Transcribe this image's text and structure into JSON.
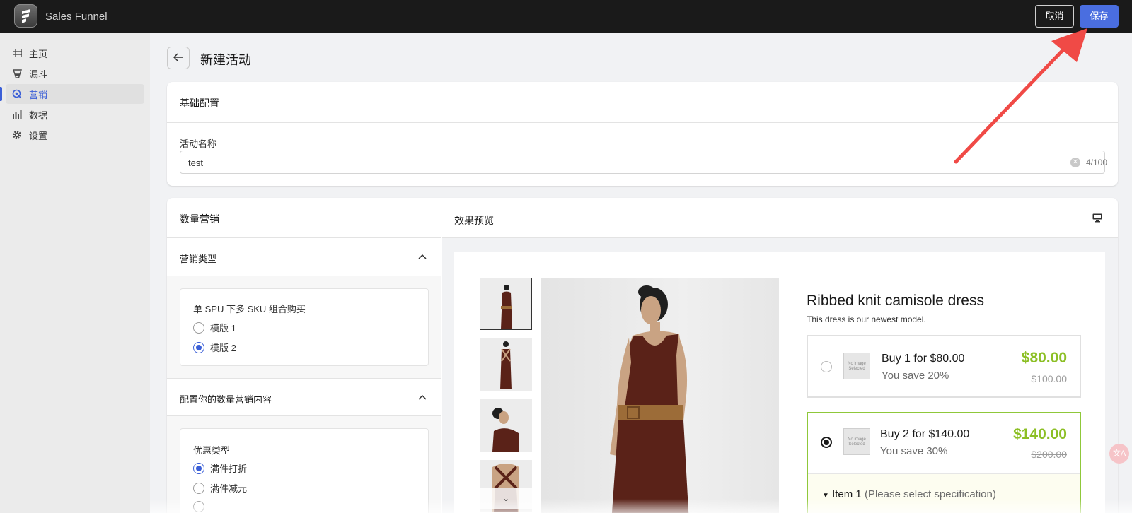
{
  "app": {
    "name": "Sales Funnel",
    "logo_icon": "funnel-logo-icon"
  },
  "topbar": {
    "cancel_label": "取消",
    "save_label": "保存",
    "save_color": "#4a6ee0"
  },
  "sidebar": {
    "items": [
      {
        "label": "主页",
        "icon": "home-list-icon"
      },
      {
        "label": "漏斗",
        "icon": "funnel-icon"
      },
      {
        "label": "营销",
        "icon": "marketing-icon",
        "active": true
      },
      {
        "label": "数据",
        "icon": "chart-icon"
      },
      {
        "label": "设置",
        "icon": "gear-icon"
      }
    ],
    "accent": "#3b5fd7"
  },
  "page": {
    "title": "新建活动"
  },
  "basic": {
    "title": "基础配置",
    "name_label": "活动名称",
    "name_value": "test",
    "name_count": "4/100"
  },
  "quantity": {
    "title": "数量营销",
    "type_section": "营销类型",
    "type_group_label": "单 SPU 下多 SKU 组合购买",
    "type_options": [
      {
        "label": "模版 1",
        "checked": false
      },
      {
        "label": "模版 2",
        "checked": true
      }
    ],
    "content_section": "配置你的数量营销内容",
    "discount_label": "优惠类型",
    "discount_options": [
      {
        "label": "满件打折",
        "checked": true
      },
      {
        "label": "满件减元",
        "checked": false
      }
    ]
  },
  "preview": {
    "title": "效果预览",
    "product_title": "Ribbed knit camisole dress",
    "product_desc": "This dress is our newest model.",
    "no_image_text": "No image Selected",
    "options": [
      {
        "name": "Buy 1 for $80.00",
        "save": "You save 20%",
        "price": "$80.00",
        "original": "$100.00",
        "selected": false
      },
      {
        "name": "Buy 2 for $140.00",
        "save": "You save 30%",
        "price": "$140.00",
        "original": "$200.00",
        "selected": true
      }
    ],
    "item_label": "Item 1",
    "item_hint": "(Please select specification)",
    "price_color": "#8cbf25",
    "selected_border": "#8fc83a"
  }
}
